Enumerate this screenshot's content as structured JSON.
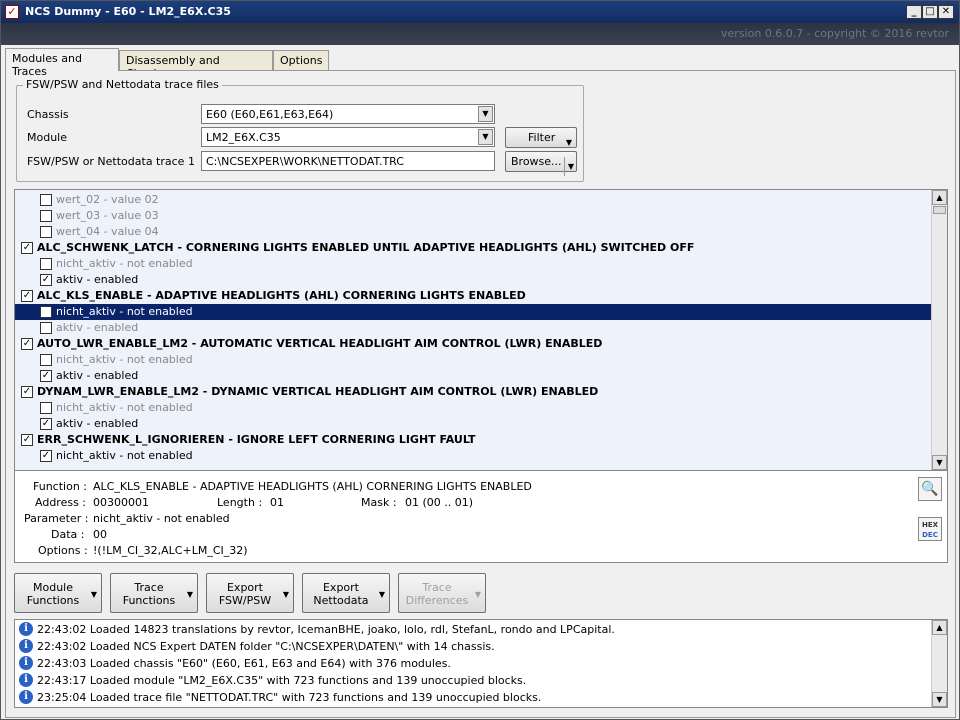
{
  "window": {
    "title": "NCS Dummy - E60 - LM2_E6X.C35",
    "version": "version 0.6.0.7 - copyright © 2016 revtor"
  },
  "tabs": [
    "Modules and Traces",
    "Disassembly and Checksums",
    "Options"
  ],
  "files_group": {
    "legend": "FSW/PSW and Nettodata trace files",
    "chassis_label": "Chassis",
    "chassis_value": "E60  (E60,E61,E63,E64)",
    "module_label": "Module",
    "module_value": "LM2_E6X.C35",
    "trace_label": "FSW/PSW or Nettodata trace 1",
    "trace_value": "C:\\NCSEXPER\\WORK\\NETTODAT.TRC",
    "filter_label": "Filter",
    "browse_label": "Browse..."
  },
  "tree": [
    {
      "level": 1,
      "text": "wert_02  -  value 02",
      "checked": false,
      "style": "off"
    },
    {
      "level": 1,
      "text": "wert_03  -  value 03",
      "checked": false,
      "style": "off"
    },
    {
      "level": 1,
      "text": "wert_04  -  value 04",
      "checked": false,
      "style": "off"
    },
    {
      "level": 0,
      "text": "ALC_SCHWENK_LATCH  -  CORNERING LIGHTS ENABLED UNTIL ADAPTIVE HEADLIGHTS (AHL) SWITCHED OFF",
      "checked": true,
      "style": "fn"
    },
    {
      "level": 1,
      "text": "nicht_aktiv  -  not enabled",
      "checked": false,
      "style": "off"
    },
    {
      "level": 1,
      "text": "aktiv  -  enabled",
      "checked": true,
      "style": "on"
    },
    {
      "level": 0,
      "text": "ALC_KLS_ENABLE  -  ADAPTIVE HEADLIGHTS (AHL) CORNERING LIGHTS ENABLED",
      "checked": true,
      "style": "fn"
    },
    {
      "level": 1,
      "text": "nicht_aktiv  -  not enabled",
      "checked": true,
      "style": "sel"
    },
    {
      "level": 1,
      "text": "aktiv  -  enabled",
      "checked": false,
      "style": "off"
    },
    {
      "level": 0,
      "text": "AUTO_LWR_ENABLE_LM2  -  AUTOMATIC VERTICAL HEADLIGHT AIM CONTROL (LWR) ENABLED",
      "checked": true,
      "style": "fn"
    },
    {
      "level": 1,
      "text": "nicht_aktiv  -  not enabled",
      "checked": false,
      "style": "off"
    },
    {
      "level": 1,
      "text": "aktiv  -  enabled",
      "checked": true,
      "style": "on"
    },
    {
      "level": 0,
      "text": "DYNAM_LWR_ENABLE_LM2  -  DYNAMIC VERTICAL HEADLIGHT AIM CONTROL (LWR) ENABLED",
      "checked": true,
      "style": "fn"
    },
    {
      "level": 1,
      "text": "nicht_aktiv  -  not enabled",
      "checked": false,
      "style": "off"
    },
    {
      "level": 1,
      "text": "aktiv  -  enabled",
      "checked": true,
      "style": "on"
    },
    {
      "level": 0,
      "text": "ERR_SCHWENK_L_IGNORIEREN  -  IGNORE LEFT CORNERING LIGHT FAULT",
      "checked": true,
      "style": "fn"
    },
    {
      "level": 1,
      "text": "nicht_aktiv  -  not enabled",
      "checked": true,
      "style": "on"
    }
  ],
  "details": {
    "function_label": "Function :",
    "function_value": "ALC_KLS_ENABLE  -  ADAPTIVE HEADLIGHTS (AHL) CORNERING LIGHTS ENABLED",
    "address_label": "Address :",
    "address_value": "00300001",
    "length_label": "Length :",
    "length_value": "01",
    "mask_label": "Mask :",
    "mask_value": "01  (00 .. 01)",
    "parameter_label": "Parameter :",
    "parameter_value": "nicht_aktiv  -  not enabled",
    "data_label": "Data :",
    "data_value": "00",
    "options_label": "Options :",
    "options_value": "!(!LM_CI_32,ALC+LM_CI_32)",
    "hexdec_top": "HEX",
    "hexdec_bottom": "DEC"
  },
  "actions": [
    {
      "line1": "Module",
      "line2": "Functions",
      "enabled": true
    },
    {
      "line1": "Trace",
      "line2": "Functions",
      "enabled": true
    },
    {
      "line1": "Export",
      "line2": "FSW/PSW",
      "enabled": true
    },
    {
      "line1": "Export",
      "line2": "Nettodata",
      "enabled": true
    },
    {
      "line1": "Trace",
      "line2": "Differences",
      "enabled": false
    }
  ],
  "log": [
    "22:43:02  Loaded 14823 translations by revtor, IcemanBHE, joako, lolo, rdl, StefanL, rondo and LPCapital.",
    "22:43:02  Loaded NCS Expert DATEN folder \"C:\\NCSEXPER\\DATEN\\\" with 14 chassis.",
    "22:43:03  Loaded chassis \"E60\" (E60, E61, E63 and E64) with 376 modules.",
    "22:43:17  Loaded module \"LM2_E6X.C35\" with 723 functions and 139 unoccupied blocks.",
    "23:25:04  Loaded trace file \"NETTODAT.TRC\" with 723 functions and 139 unoccupied blocks."
  ]
}
